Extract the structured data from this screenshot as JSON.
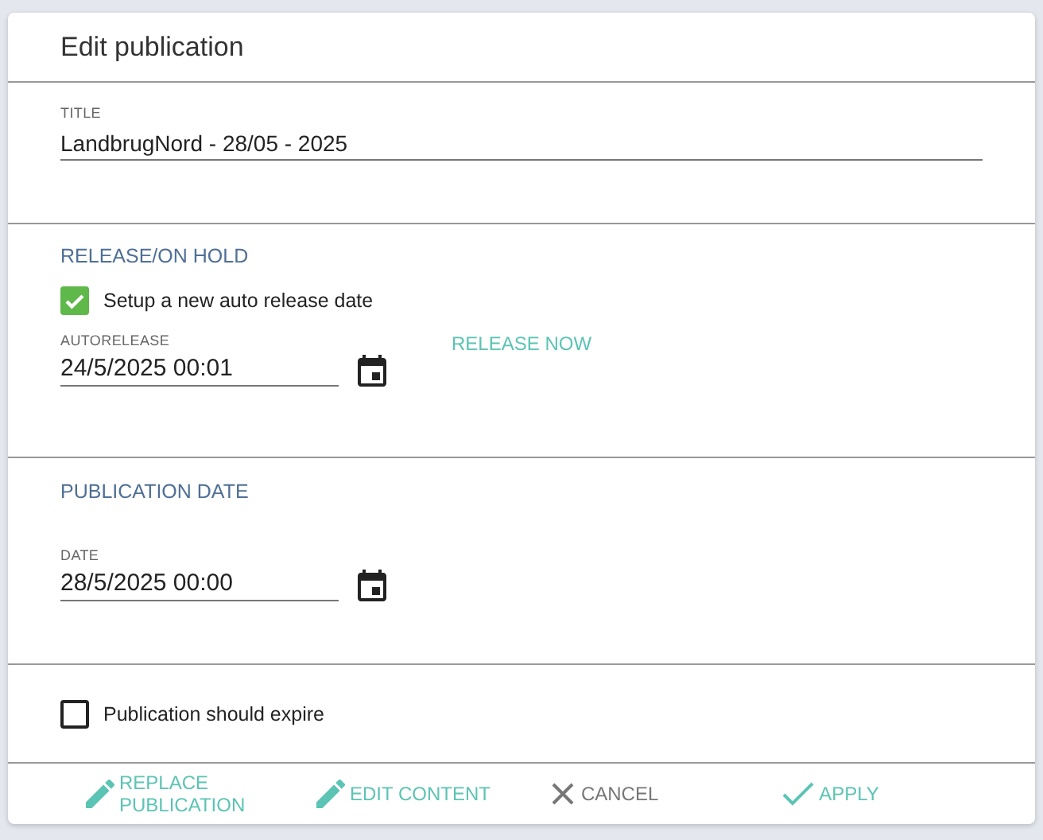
{
  "dialog": {
    "title": "Edit publication"
  },
  "title_field": {
    "label": "TITLE",
    "value": "LandbrugNord - 28/05 - 2025"
  },
  "release": {
    "heading": "RELEASE/ON HOLD",
    "checkbox": {
      "label": "Setup a new auto release date",
      "checked": true
    },
    "field": {
      "label": "AUTORELEASE",
      "value": "24/5/2025 00:01"
    },
    "release_now": "RELEASE NOW"
  },
  "publication_date": {
    "heading": "PUBLICATION DATE",
    "field": {
      "label": "DATE",
      "value": "28/5/2025 00:00"
    }
  },
  "expire": {
    "label": "Publication should expire",
    "checked": false
  },
  "buttons": [
    {
      "kind": "pencil",
      "label": "REPLACE PUBLICATION"
    },
    {
      "kind": "pencil",
      "label": "EDIT CONTENT"
    },
    {
      "kind": "cancel",
      "label": "CANCEL"
    },
    {
      "kind": "apply",
      "label": "APPLY"
    }
  ]
}
